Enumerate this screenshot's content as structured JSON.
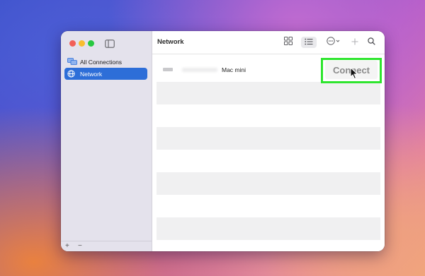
{
  "window": {
    "title": "Network"
  },
  "sidebar": {
    "items": [
      {
        "label": "All Connections",
        "icon": "monitors-icon",
        "selected": false
      },
      {
        "label": "Network",
        "icon": "globe-icon",
        "selected": true
      }
    ],
    "add_label": "+",
    "remove_label": "−"
  },
  "toolbar": {
    "buttons": [
      "grid-view-icon",
      "list-view-icon",
      "more-options-icon",
      "add-icon",
      "search-icon"
    ]
  },
  "list": {
    "items": [
      {
        "name": "Mac mini",
        "action_label": "Connect"
      }
    ]
  },
  "colors": {
    "accent": "#2d6ed8",
    "highlight": "#2ee52e"
  }
}
